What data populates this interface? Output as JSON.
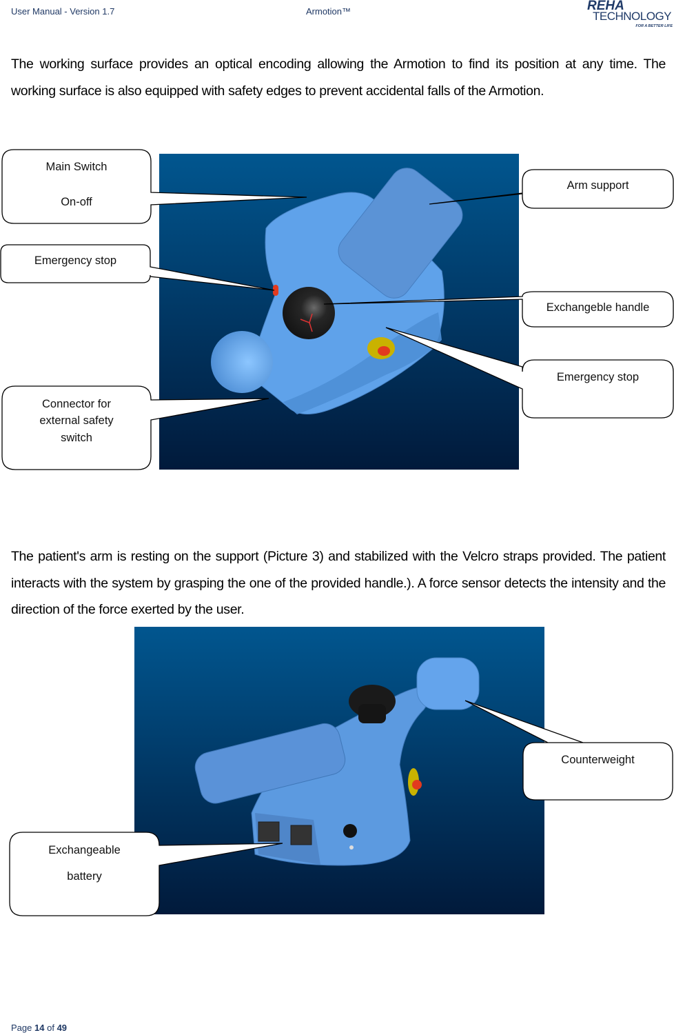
{
  "header": {
    "left": "User Manual - Version 1.7",
    "center": "Armotion™",
    "logo": {
      "line1": "REHA",
      "line2": "TECHNOLOGY",
      "tagline": "FOR A BETTER LIFE"
    }
  },
  "paragraphs": [
    "The working surface provides an optical encoding allowing the Armotion to find its position at any time. The working surface is also equipped with safety edges to prevent accidental falls of the Armotion.",
    "The patient's arm is resting on the support (Picture 3) and stabilized with the Velcro straps provided. The patient interacts with the system by grasping the one of the provided handle.). A force sensor detects the intensity and the direction of the force exerted by the user."
  ],
  "figure1": {
    "description": "Armotion device rendered top view",
    "callouts": {
      "main_switch_line1": "Main Switch",
      "main_switch_line2": "On-off",
      "emergency_stop_left": "Emergency stop",
      "connector_line1": "Connector for",
      "connector_line2": "external safety",
      "connector_line3": "switch",
      "arm_support": "Arm support",
      "handle": "Exchangeble handle",
      "emergency_stop_right": "Emergency stop"
    }
  },
  "figure2": {
    "description": "Armotion device rendered rear view",
    "callouts": {
      "counterweight": "Counterweight",
      "battery_line1": "Exchangeable",
      "battery_line2": "battery"
    }
  },
  "colors": {
    "header_text": "#1f3864",
    "bg_top": "#01568f",
    "bg_bottom": "#011a3b",
    "device_blue": "#6aa9ef",
    "estop_red": "#e23a1e"
  },
  "footer": {
    "page_label": "Page",
    "page_current": "14",
    "of_label": "of",
    "page_total": "49"
  }
}
